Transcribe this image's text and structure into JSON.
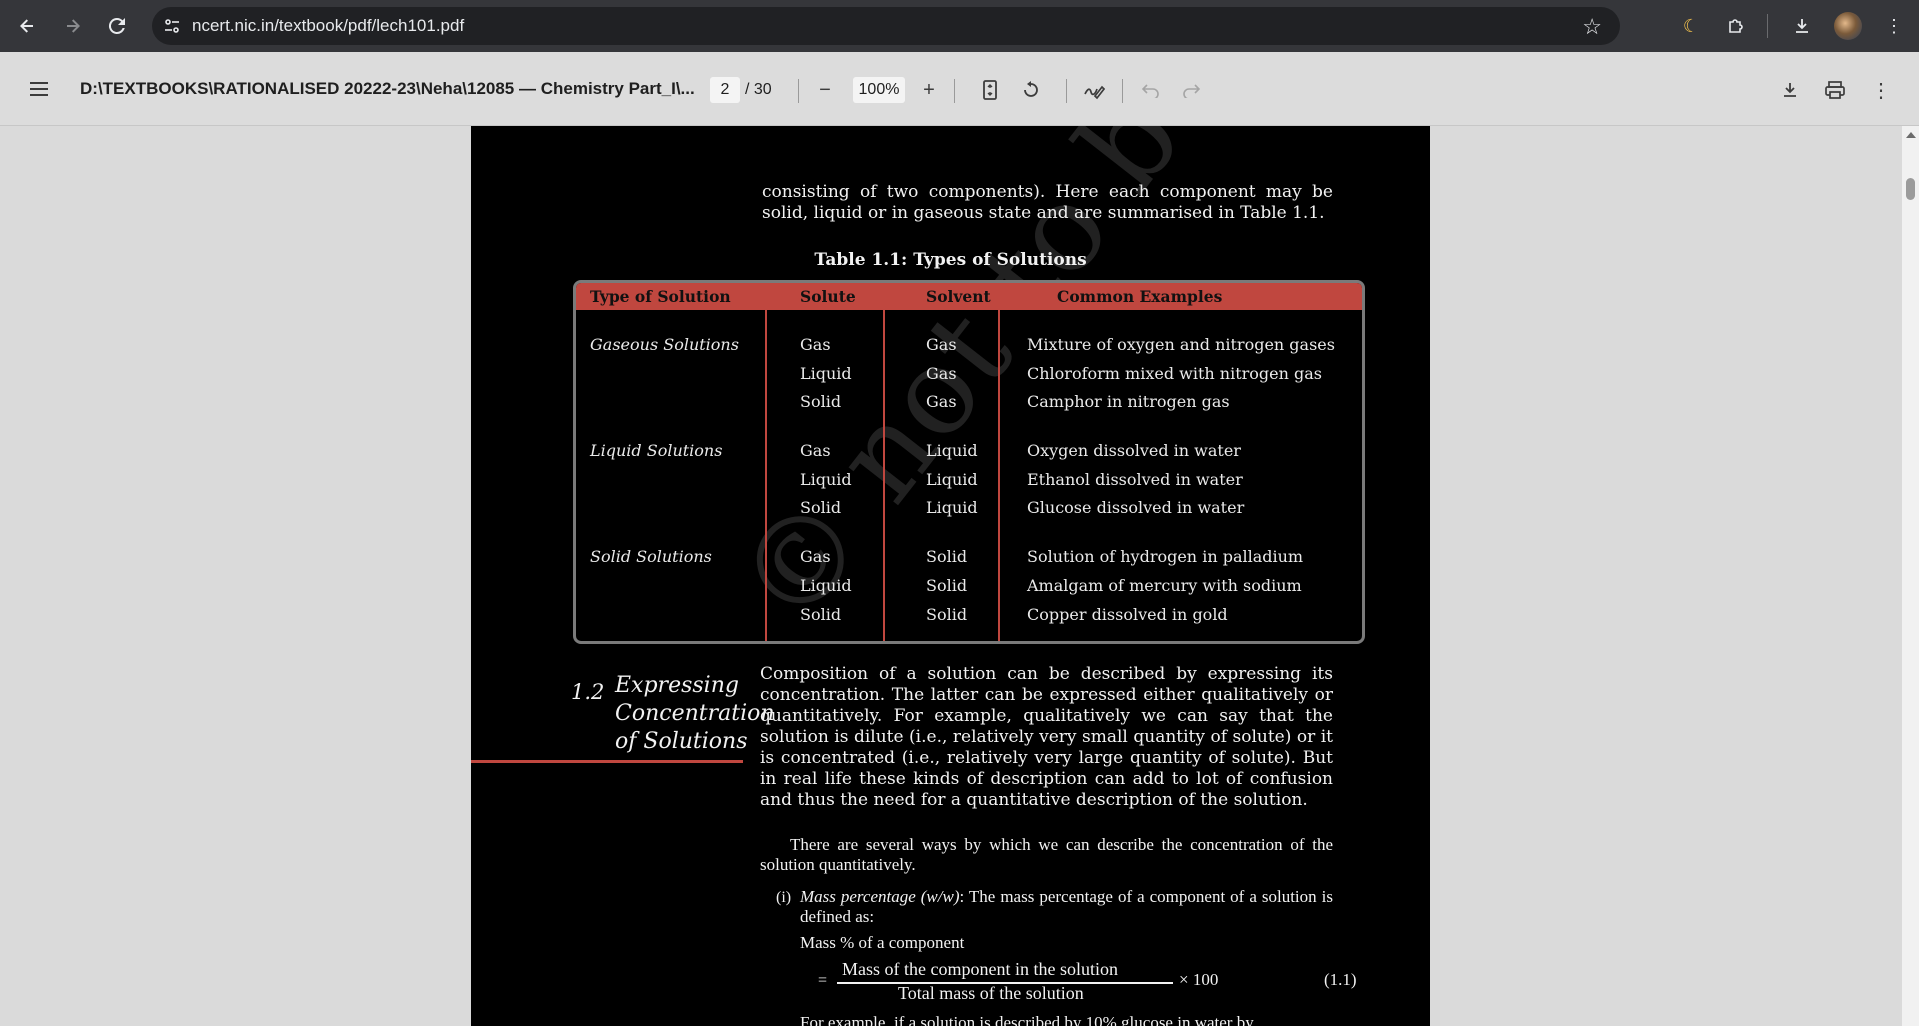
{
  "browser": {
    "url": "ncert.nic.in/textbook/pdf/lech101.pdf"
  },
  "pdf_toolbar": {
    "title": "D:\\TEXTBOOKS\\RATIONALISED 20222-23\\Neha\\12085 — Chemistry Part_I\\...",
    "page_current": "2",
    "page_total": "/ 30",
    "zoom": "100%"
  },
  "page": {
    "intro_text": "consisting of two components). Here each component may be solid, liquid or in gaseous state and are summarised in Table 1.1.",
    "table_caption": "Table 1.1: Types of Solutions",
    "table_headers": [
      "Type of Solution",
      "Solute",
      "Solvent",
      "Common Examples"
    ],
    "table_groups": [
      {
        "type": "Gaseous Solutions",
        "rows": [
          [
            "Gas",
            "Gas",
            "Mixture of oxygen and nitrogen gases"
          ],
          [
            "Liquid",
            "Gas",
            "Chloroform mixed with nitrogen gas"
          ],
          [
            "Solid",
            "Gas",
            "Camphor in nitrogen gas"
          ]
        ]
      },
      {
        "type": "Liquid Solutions",
        "rows": [
          [
            "Gas",
            "Liquid",
            "Oxygen dissolved in water"
          ],
          [
            "Liquid",
            "Liquid",
            "Ethanol dissolved in water"
          ],
          [
            "Solid",
            "Liquid",
            "Glucose dissolved in water"
          ]
        ]
      },
      {
        "type": "Solid Solutions",
        "rows": [
          [
            "Gas",
            "Solid",
            "Solution of hydrogen in palladium"
          ],
          [
            "Liquid",
            "Solid",
            "Amalgam of mercury with sodium"
          ],
          [
            "Solid",
            "Solid",
            "Copper dissolved in gold"
          ]
        ]
      }
    ],
    "section_number": "1.2",
    "section_title": "Expressing Concentration of Solutions",
    "section_para": "Composition of a solution can be described by expressing its concentration. The latter can be expressed either qualitatively or quantitatively. For example, qualitatively we can say that the solution is dilute (i.e., relatively very small quantity of solute) or it is concentrated (i.e., relatively very large quantity of solute). But in real life these kinds of description can add to lot of confusion and thus the need for a quantitative description of the solution.",
    "ways_para": "There are several ways by which we can describe the concentration of the solution quantitatively.",
    "item_number": "(i)",
    "item_term": "Mass percentage (w/w)",
    "item_text": ": The mass percentage of a component of a solution is defined as:",
    "mass_percent_label": "Mass % of a component",
    "formula_equals": "=",
    "formula_numerator": "Mass of the component in the solution",
    "formula_denominator": "Total mass of the solution",
    "formula_multiplier": "× 100",
    "equation_number": "(1.1)",
    "cut_off_text": "For example, if a solution is described by 10% glucose in water by",
    "watermark": "© not to be republished"
  }
}
